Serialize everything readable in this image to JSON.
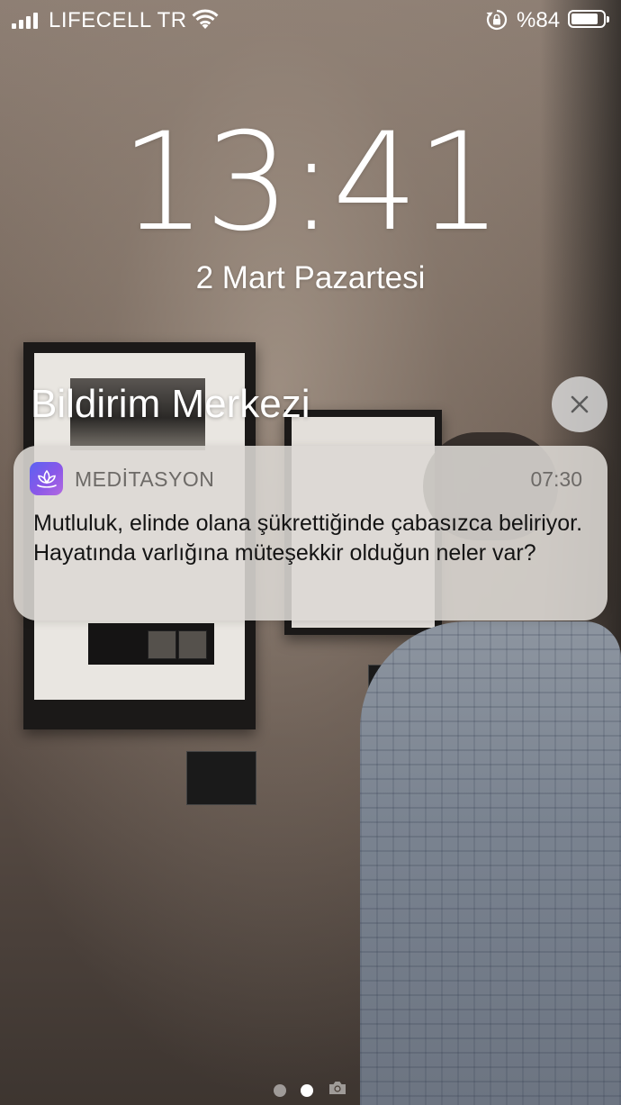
{
  "status_bar": {
    "carrier": "LIFECELL TR",
    "battery_percent": "%84",
    "battery_level": 0.84,
    "signal_bars_active": 4,
    "icons": [
      "signal-icon",
      "wifi-icon",
      "rotation-lock-icon",
      "battery-icon"
    ]
  },
  "lock_screen": {
    "time": "13:41",
    "date": "2 Mart Pazartesi"
  },
  "notification_center": {
    "title": "Bildirim Merkezi",
    "close_icon": "close-icon"
  },
  "notification": {
    "app_name": "MEDİTASYON",
    "time": "07:30",
    "body": "Mutluluk, elinde olana şükrettiğinde çabasızca beliriyor. Hayatında varlığına müteşekkir olduğun neler var?",
    "app_icon": "lotus-icon",
    "app_icon_color": "#7a5cf0"
  },
  "page_indicator": {
    "pages": 2,
    "active_index": 1,
    "trailing_icon": "camera-icon"
  }
}
